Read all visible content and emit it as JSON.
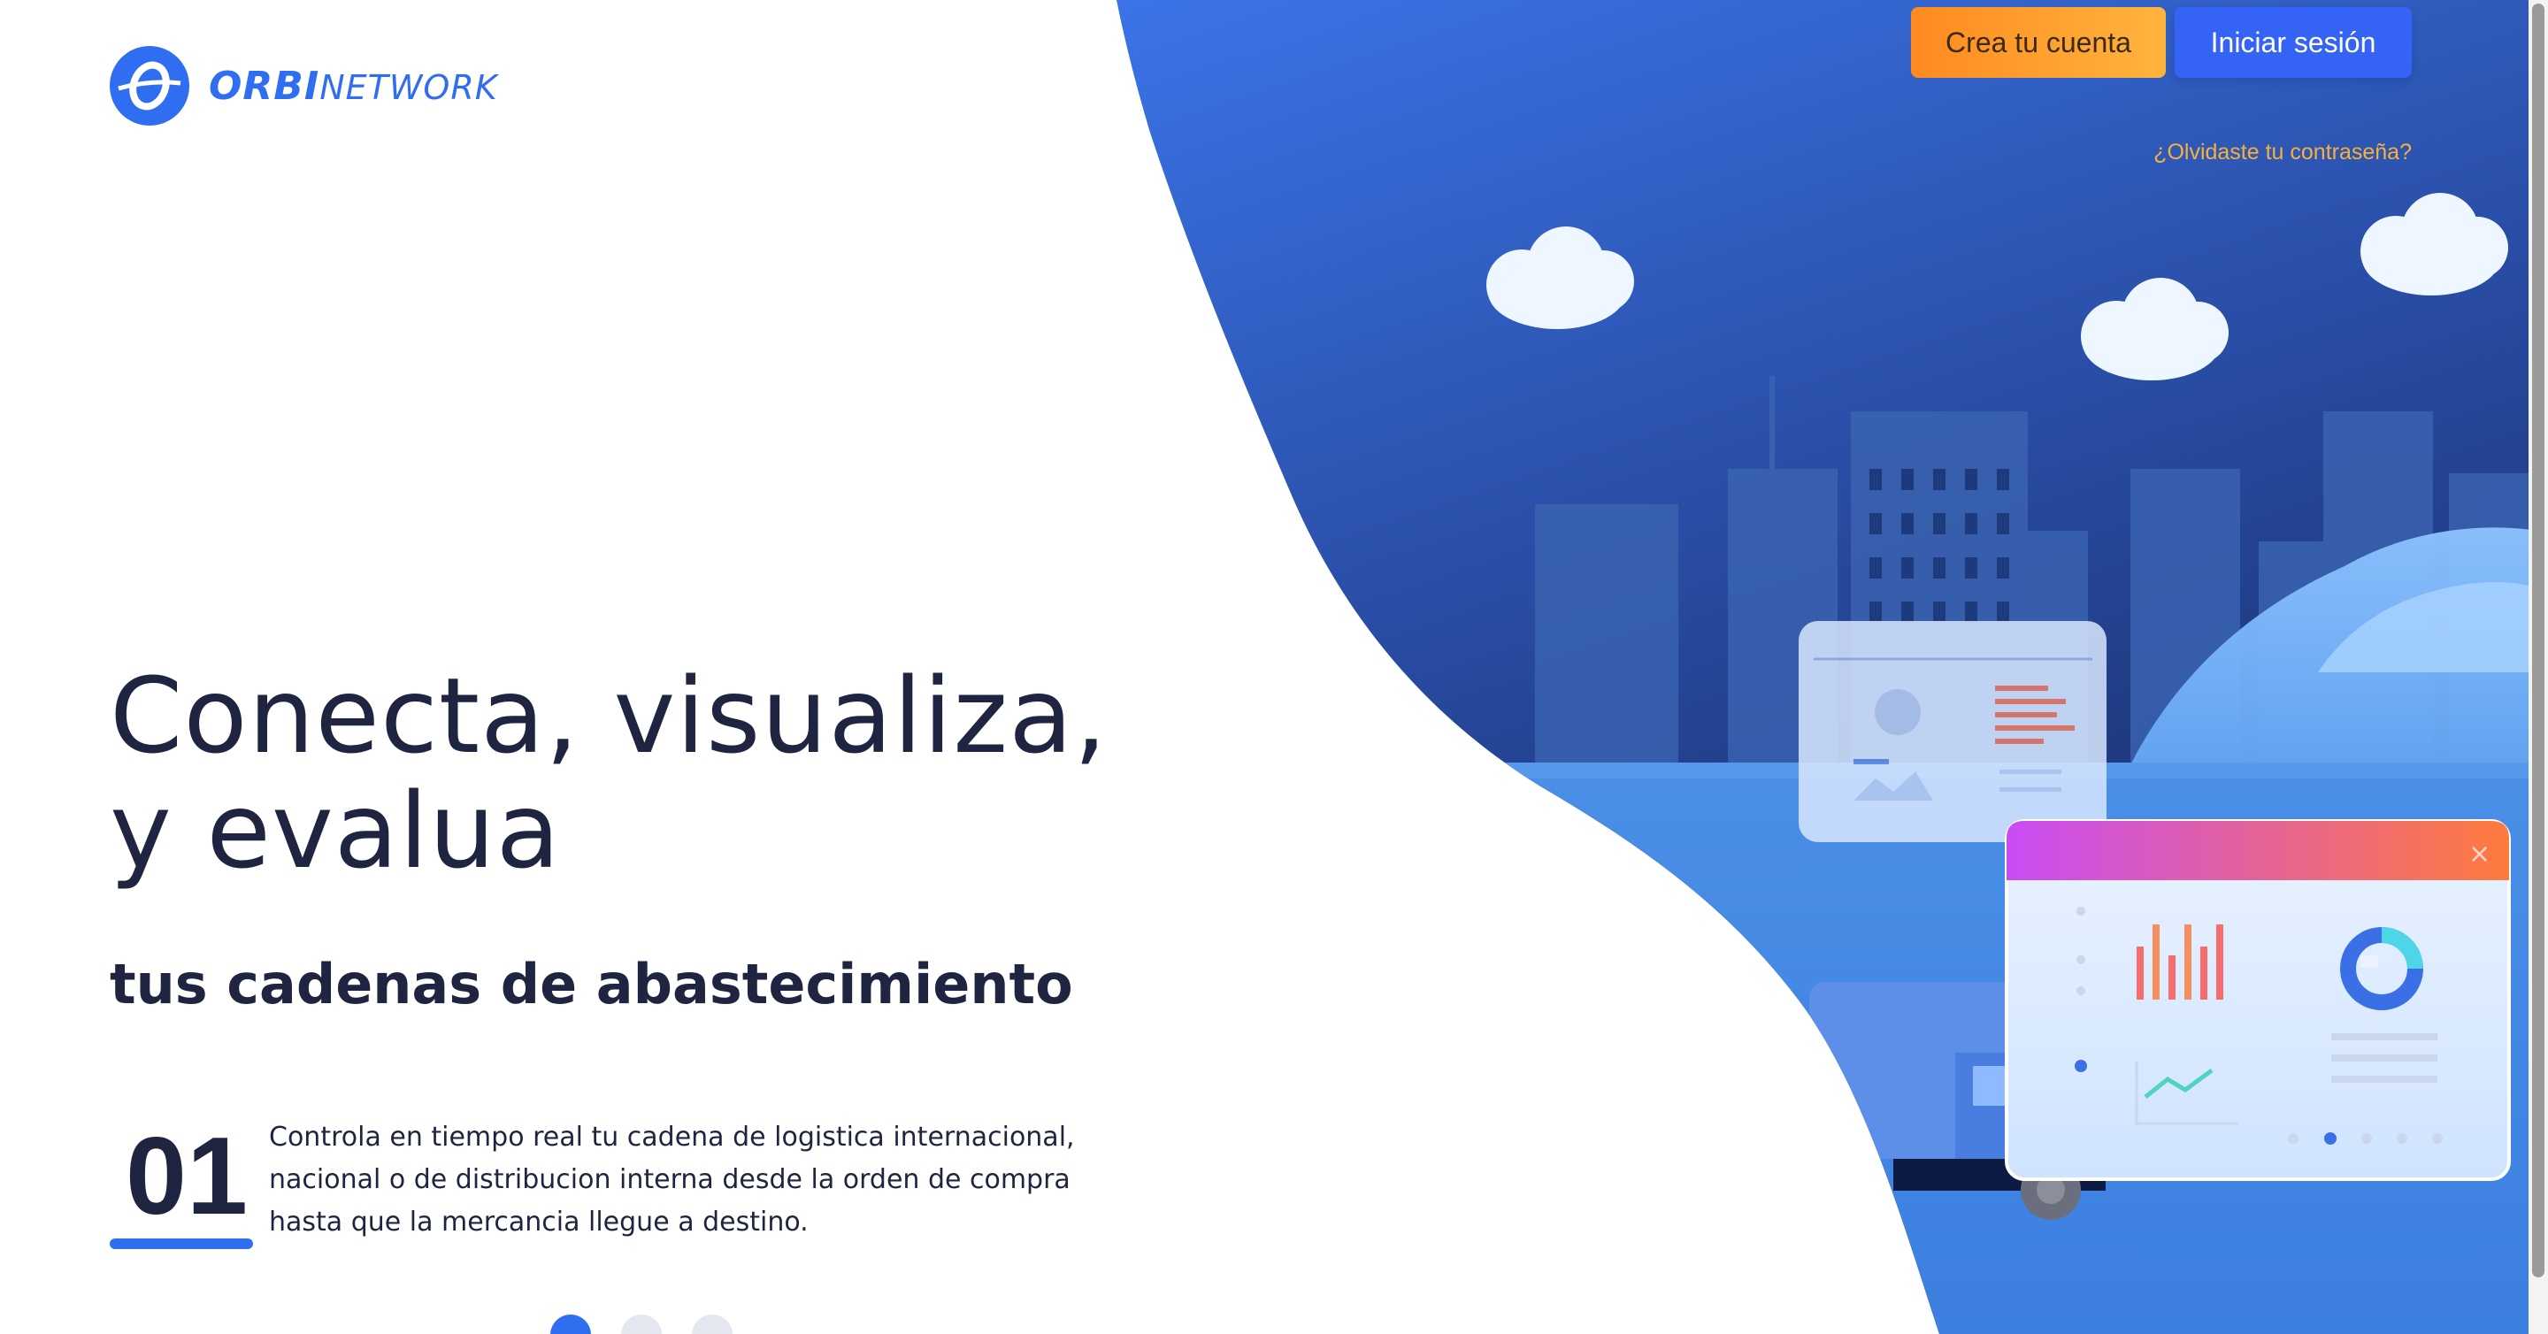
{
  "brand": {
    "name_bold": "ORBI",
    "name_light": "NETWORK",
    "logo_icon": "orbit-logo-icon"
  },
  "header": {
    "create_account_label": "Crea tu cuenta",
    "login_label": "Iniciar sesión",
    "forgot_password_label": "¿Olvidaste tu contraseña?"
  },
  "hero": {
    "headline_line1": "Conecta, visualiza,",
    "headline_line2": "y evalua",
    "subheadline": "tus cadenas de abastecimiento"
  },
  "feature": {
    "number": "01",
    "description": "Controla en tiempo real tu cadena de logistica internacional, nacional o de distribucion interna desde la orden de compra hasta que la mercancia llegue a destino."
  },
  "carousel": {
    "total_slides": 3,
    "active_slide": 1
  },
  "colors": {
    "accent": "#2f6ef0",
    "create_button": "#ff8a1f",
    "login_button": "#3563f5",
    "forgot_link": "#f6b13c",
    "text_dark": "#1f2540"
  },
  "illustration": {
    "icons": [
      "cloud-icon",
      "building-icon",
      "dashboard-card-icon",
      "truck-icon",
      "donut-chart-icon",
      "bar-chart-icon"
    ]
  }
}
